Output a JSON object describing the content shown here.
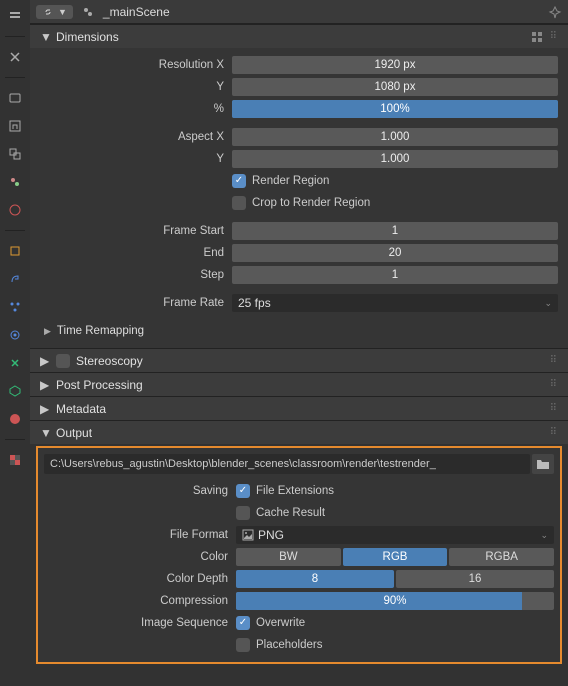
{
  "header": {
    "scene_name": "_mainScene"
  },
  "panels": {
    "dimensions": {
      "title": "Dimensions",
      "resolution_x_label": "Resolution X",
      "resolution_x": "1920 px",
      "resolution_y_label": "Y",
      "resolution_y": "1080 px",
      "resolution_pct_label": "%",
      "resolution_pct": "100%",
      "aspect_x_label": "Aspect X",
      "aspect_x": "1.000",
      "aspect_y_label": "Y",
      "aspect_y": "1.000",
      "render_region_label": "Render Region",
      "crop_label": "Crop to Render Region",
      "frame_start_label": "Frame Start",
      "frame_start": "1",
      "frame_end_label": "End",
      "frame_end": "20",
      "frame_step_label": "Step",
      "frame_step": "1",
      "frame_rate_label": "Frame Rate",
      "frame_rate": "25 fps",
      "time_remapping": "Time Remapping"
    },
    "stereoscopy": {
      "title": "Stereoscopy"
    },
    "post_processing": {
      "title": "Post Processing"
    },
    "metadata": {
      "title": "Metadata"
    },
    "output": {
      "title": "Output",
      "path": "C:\\Users\\rebus_agustin\\Desktop\\blender_scenes\\classroom\\render\\testrender_",
      "saving_label": "Saving",
      "file_extensions_label": "File Extensions",
      "cache_result_label": "Cache Result",
      "file_format_label": "File Format",
      "file_format": "PNG",
      "color_label": "Color",
      "color_opts": {
        "bw": "BW",
        "rgb": "RGB",
        "rgba": "RGBA"
      },
      "color_depth_label": "Color Depth",
      "depth_opts": {
        "d8": "8",
        "d16": "16"
      },
      "compression_label": "Compression",
      "compression": "90%",
      "image_sequence_label": "Image Sequence",
      "overwrite_label": "Overwrite",
      "placeholders_label": "Placeholders"
    }
  }
}
